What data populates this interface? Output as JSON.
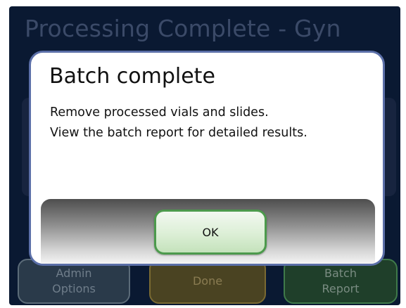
{
  "screen": {
    "title": "Processing Complete - Gyn"
  },
  "bottom_bar": {
    "admin_options": {
      "line1": "Admin",
      "line2": "Options"
    },
    "done": {
      "label": "Done"
    },
    "batch_report": {
      "line1": "Batch",
      "line2": "Report"
    }
  },
  "dialog": {
    "title": "Batch complete",
    "line1": "Remove processed vials and slides.",
    "line2": "View the batch report for detailed results.",
    "ok_label": "OK"
  },
  "colors": {
    "background": "#0a1932",
    "dialog_border": "#5b6fa8",
    "ok_border": "#4c9a4c",
    "admin_button": "#2a3a4a",
    "done_button": "#4a4322",
    "report_button": "#1f3f2a"
  }
}
